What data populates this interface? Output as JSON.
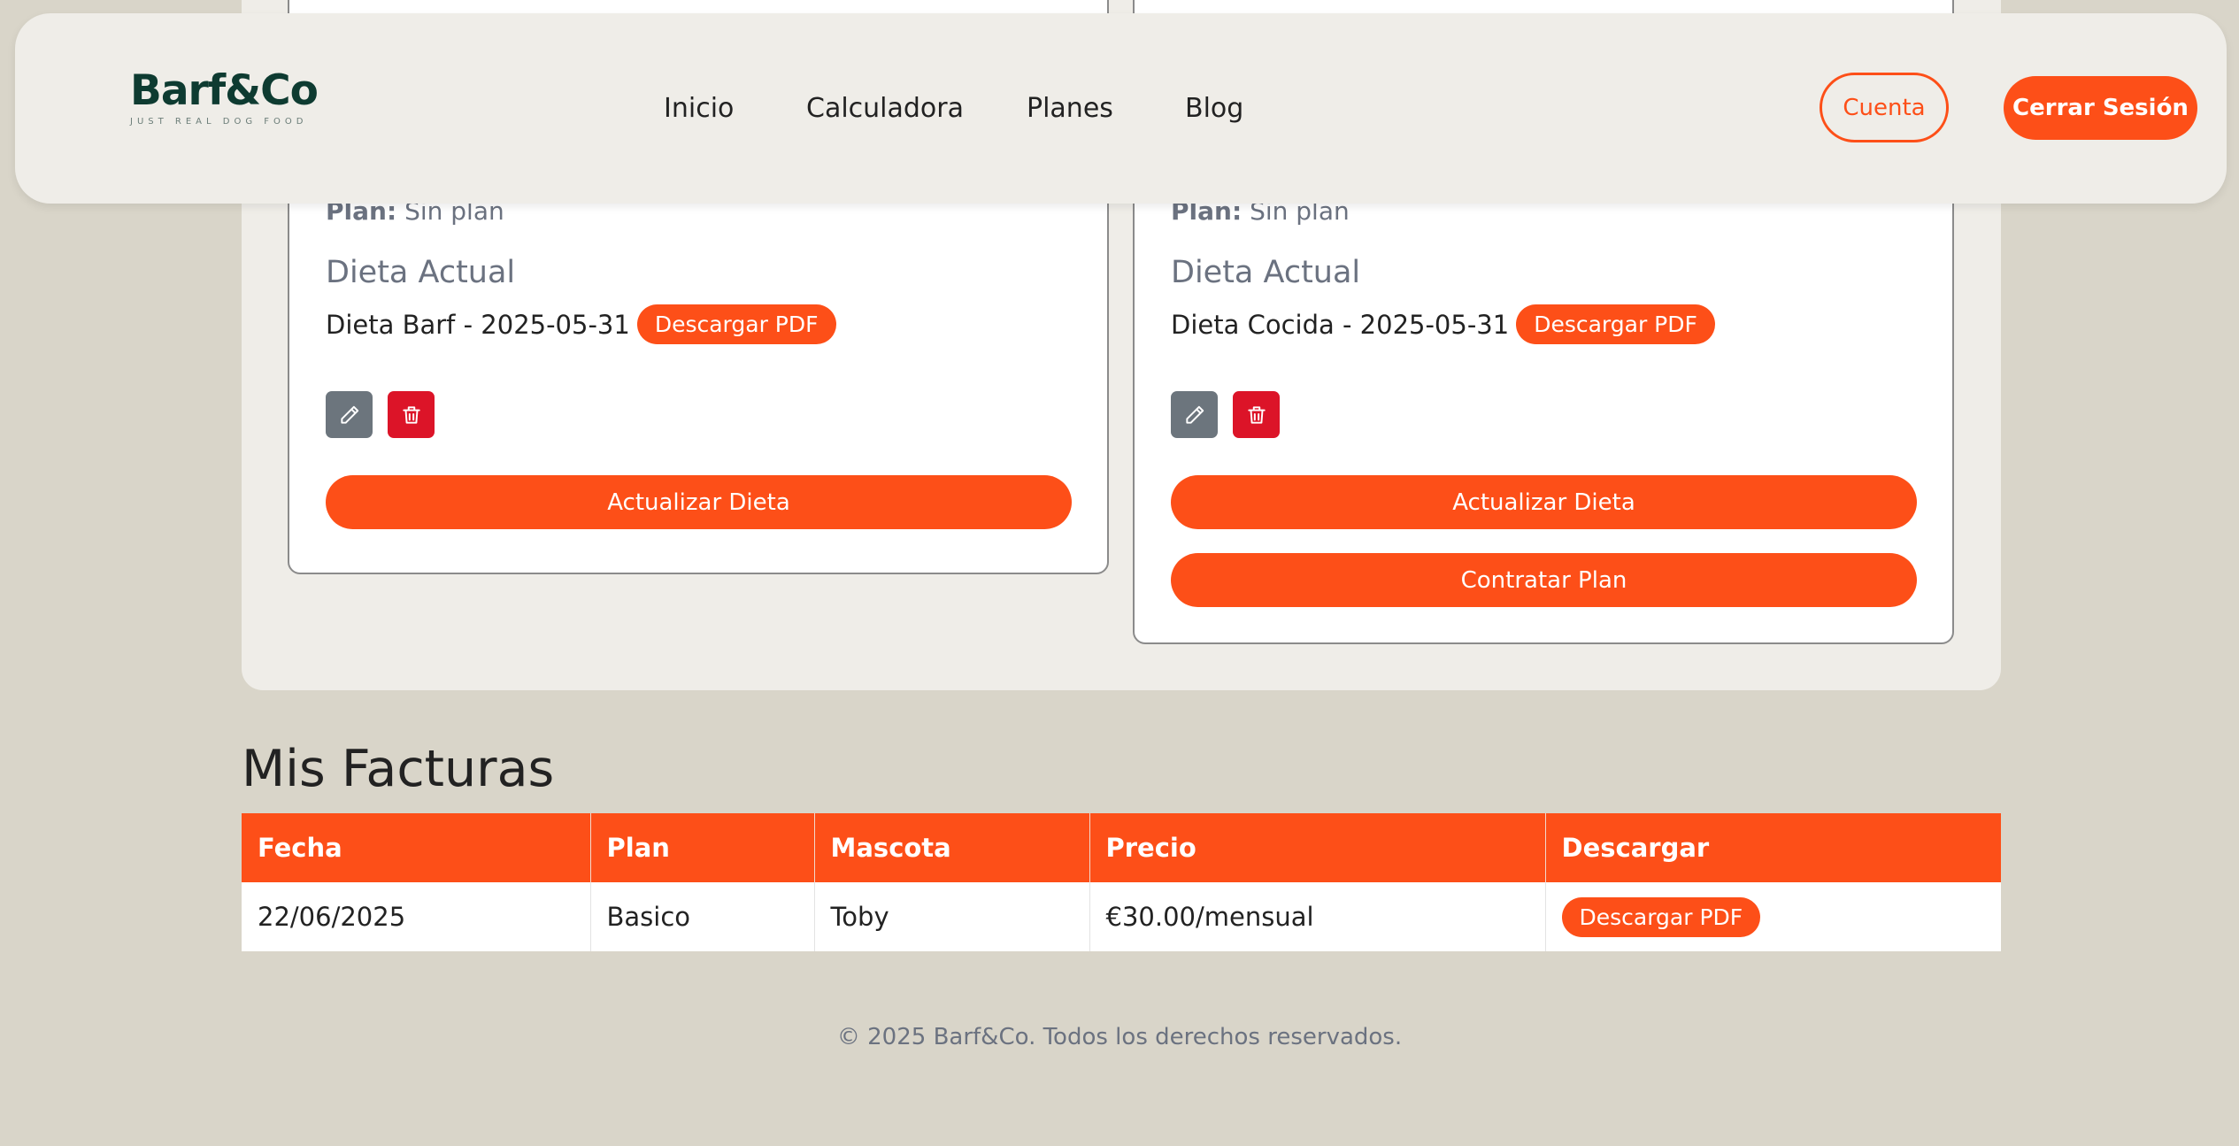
{
  "header": {
    "logo": "Barf&Co",
    "tagline": "JUST REAL DOG FOOD",
    "nav": [
      "Inicio",
      "Calculadora",
      "Planes",
      "Blog"
    ],
    "account_label": "Cuenta",
    "logout_label": "Cerrar Sesión"
  },
  "pets": [
    {
      "plan_label": "Plan:",
      "plan_value": "Sin plan",
      "diet_title": "Dieta Actual",
      "diet_text": "Dieta Barf - 2025-05-31",
      "pdf_label": "Descargar PDF",
      "update_label": "Actualizar Dieta"
    },
    {
      "plan_label": "Plan:",
      "plan_value": "Sin plan",
      "diet_title": "Dieta Actual",
      "diet_text": "Dieta Cocida - 2025-05-31",
      "pdf_label": "Descargar PDF",
      "update_label": "Actualizar Dieta",
      "contract_label": "Contratar Plan"
    }
  ],
  "invoices": {
    "title": "Mis Facturas",
    "columns": [
      "Fecha",
      "Plan",
      "Mascota",
      "Precio",
      "Descargar"
    ],
    "rows": [
      {
        "fecha": "22/06/2025",
        "plan": "Basico",
        "mascota": "Toby",
        "precio": "€30.00/mensual",
        "download_label": "Descargar PDF"
      }
    ]
  },
  "footer": {
    "text": "© 2025 Barf&Co. Todos los derechos reservados."
  },
  "colors": {
    "accent": "#fd4f18",
    "background": "#d9d5c9",
    "panel": "#efede8",
    "brand": "#0e3b31",
    "edit_button": "#6c757d",
    "delete_button": "#dc1428"
  }
}
